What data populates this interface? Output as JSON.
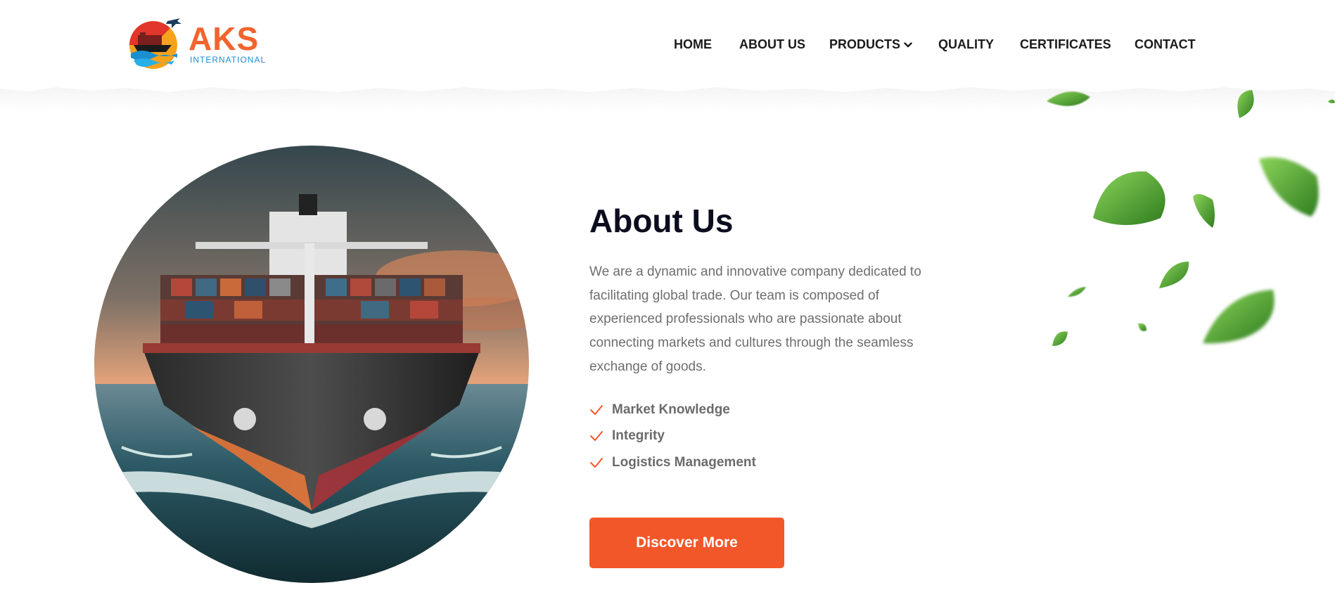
{
  "brand": {
    "name": "AKS",
    "tagline": "INTERNATIONAL",
    "colors": {
      "primary": "#f2642e",
      "secondary": "#1a8fd0"
    }
  },
  "nav": {
    "items": [
      {
        "label": "HOME"
      },
      {
        "label": "ABOUT US"
      },
      {
        "label": "PRODUCTS",
        "has_dropdown": true
      },
      {
        "label": "QUALITY"
      },
      {
        "label": "CERTIFICATES"
      },
      {
        "label": "CONTACT"
      }
    ]
  },
  "about": {
    "title": "About Us",
    "paragraph_lines": [
      "We are a dynamic and innovative company dedicated to",
      "facilitating global trade. Our team is composed of",
      "experienced professionals who are passionate about",
      "connecting markets and cultures through the seamless",
      "exchange of goods."
    ],
    "features": [
      {
        "label": "Market Knowledge",
        "icon": "check-icon"
      },
      {
        "label": "Integrity",
        "icon": "check-icon"
      },
      {
        "label": "Logistics Management",
        "icon": "check-icon"
      }
    ],
    "cta_label": "Discover More"
  },
  "colors": {
    "accent": "#f2572a",
    "heading": "#0c0c1f",
    "body_text": "#6e6e6e",
    "leaf_green": "#3f9a2a"
  }
}
